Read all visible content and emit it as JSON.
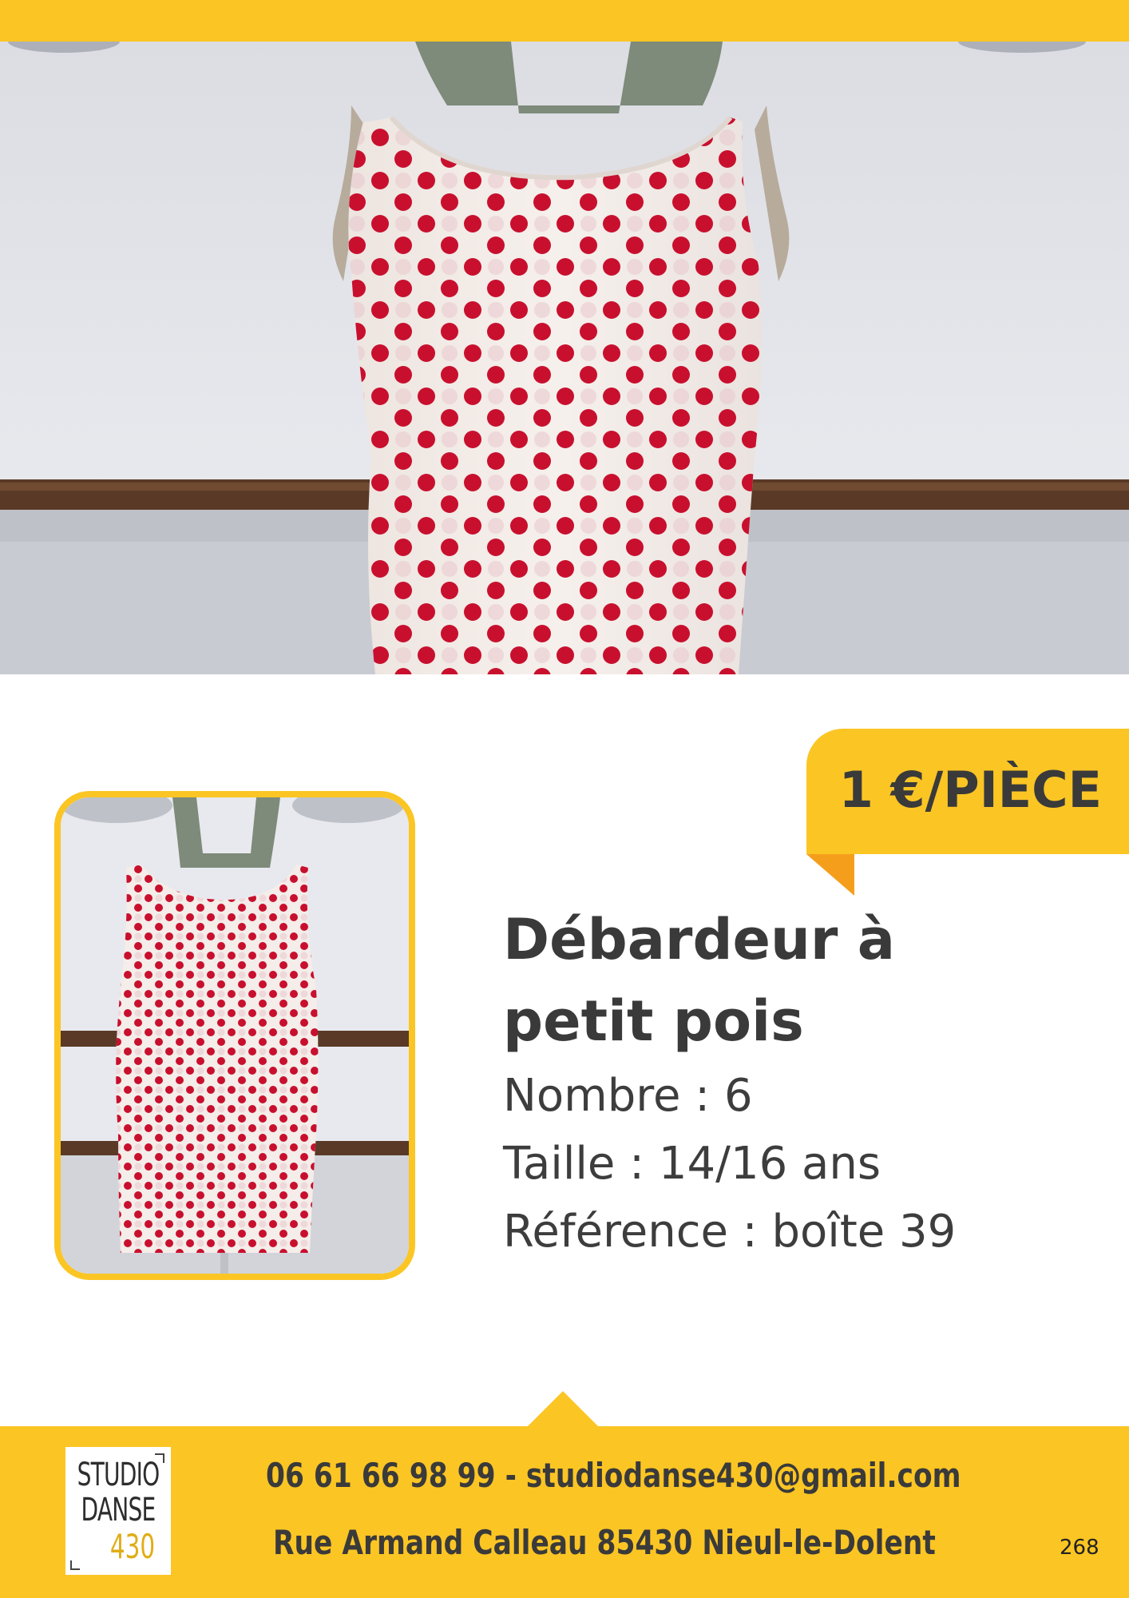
{
  "product": {
    "price": "1 €/PIÈCE",
    "title_line1": "Débardeur à",
    "title_line2": "petit pois",
    "attributes": [
      "Nombre : 6",
      "Taille : 14/16 ans",
      "Référence : boîte 39"
    ]
  },
  "footer": {
    "contact": "06 61 66 98 99 - studiodanse430@gmail.com",
    "address": "Rue Armand Calleau 85430 Nieul-le-Dolent",
    "page_number": "268",
    "logo_line1": "STUDIO",
    "logo_line2": "DANSE",
    "logo_line3": "430"
  },
  "colors": {
    "accent_yellow": "#fbc524",
    "fold_orange": "#f59e1c",
    "dot_red": "#c8102e",
    "text_dark": "#3a3a3a"
  },
  "images": {
    "hero": "photo of a white sleeveless top with red polka dots on a mannequin",
    "thumbnail": "full-length photo of the same polka-dot top on a mannequin"
  }
}
